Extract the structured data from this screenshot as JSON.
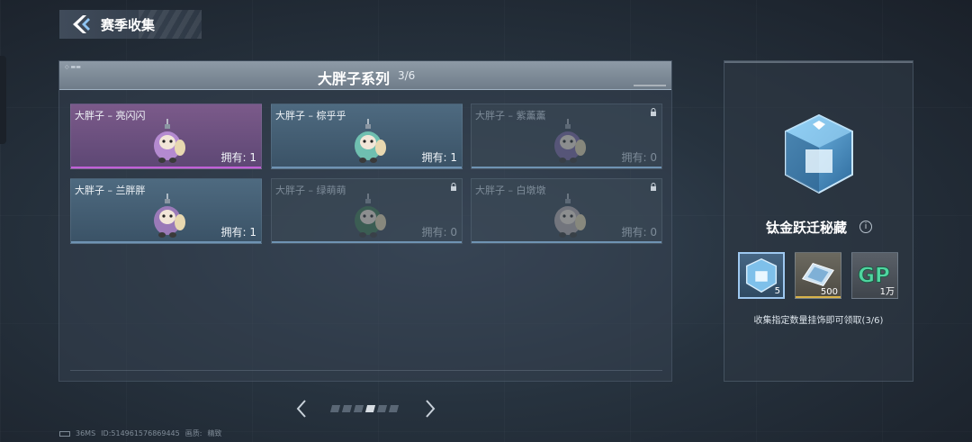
{
  "header": {
    "title": "赛季收集"
  },
  "series": {
    "title": "大胖子系列",
    "count": "3/6"
  },
  "cards": [
    {
      "name": "大胖子 – 亮闪闪",
      "own_label": "拥有: 1",
      "state": "owned",
      "rarity": "purple",
      "color": "#b48ad0"
    },
    {
      "name": "大胖子 – 棕乎乎",
      "own_label": "拥有: 1",
      "state": "owned",
      "rarity": "blue",
      "color": "#6fbfb0"
    },
    {
      "name": "大胖子 – 紫薰薰",
      "own_label": "拥有: 0",
      "state": "locked",
      "rarity": "blue",
      "color": "#7d6aa8"
    },
    {
      "name": "大胖子 – 兰胖胖",
      "own_label": "拥有: 1",
      "state": "owned",
      "rarity": "blue",
      "color": "#9a7ab8"
    },
    {
      "name": "大胖子 – 绿萌萌",
      "own_label": "拥有: 0",
      "state": "locked",
      "rarity": "blue",
      "color": "#3f7a52"
    },
    {
      "name": "大胖子 – 白墩墩",
      "own_label": "拥有: 0",
      "state": "locked",
      "rarity": "blue",
      "color": "#b8aeb0"
    }
  ],
  "pager": {
    "pages": 6,
    "current": 4
  },
  "reward": {
    "title": "钛金跃迁秘藏",
    "items": [
      {
        "name": "chest-item",
        "qty": "5"
      },
      {
        "name": "ticket-item",
        "qty": "500"
      },
      {
        "name": "gp-item",
        "qty": "1万",
        "label": "GP"
      }
    ],
    "description": "收集指定数量挂饰即可领取(3/6)"
  },
  "footer": {
    "ping": "36MS",
    "id": "ID:5149615768694​45",
    "quality_label": "画质:",
    "quality_value": "精致"
  }
}
